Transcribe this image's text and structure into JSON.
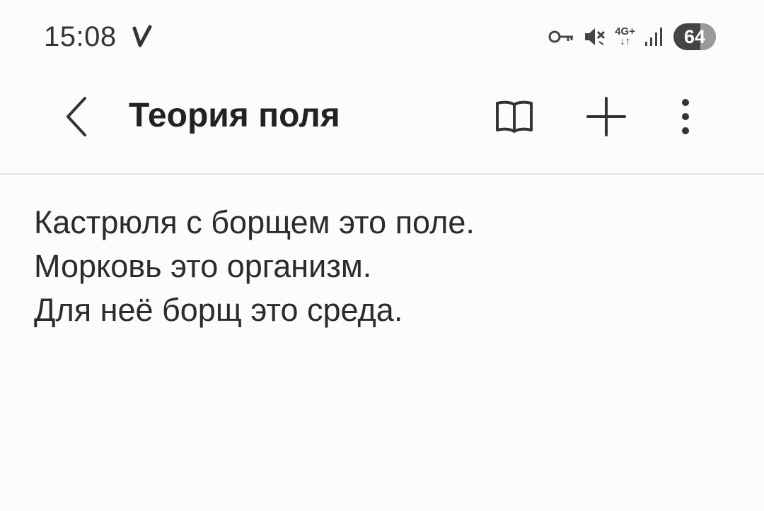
{
  "status_bar": {
    "time": "15:08",
    "battery_level": "64",
    "battery_fraction": 0.64,
    "icons": [
      "v-notification-icon",
      "key-icon",
      "mute-icon",
      "4g-network-icon",
      "signal-icon",
      "battery-icon"
    ],
    "network_label_top": "4G+",
    "network_label_bottom": "↓↑"
  },
  "app_bar": {
    "title": "Теория поля",
    "back_icon": "chevron-left-icon",
    "book_icon": "book-icon",
    "add_icon": "plus-icon",
    "more_icon": "more-vertical-icon"
  },
  "note": {
    "lines": [
      "Кастрюля с борщем это поле.",
      "Морковь это организм.",
      "Для неё борщ это среда."
    ]
  },
  "colors": {
    "background": "#fcfcfc",
    "text": "#222222",
    "divider": "#e4e4e4",
    "battery": "#444444"
  }
}
